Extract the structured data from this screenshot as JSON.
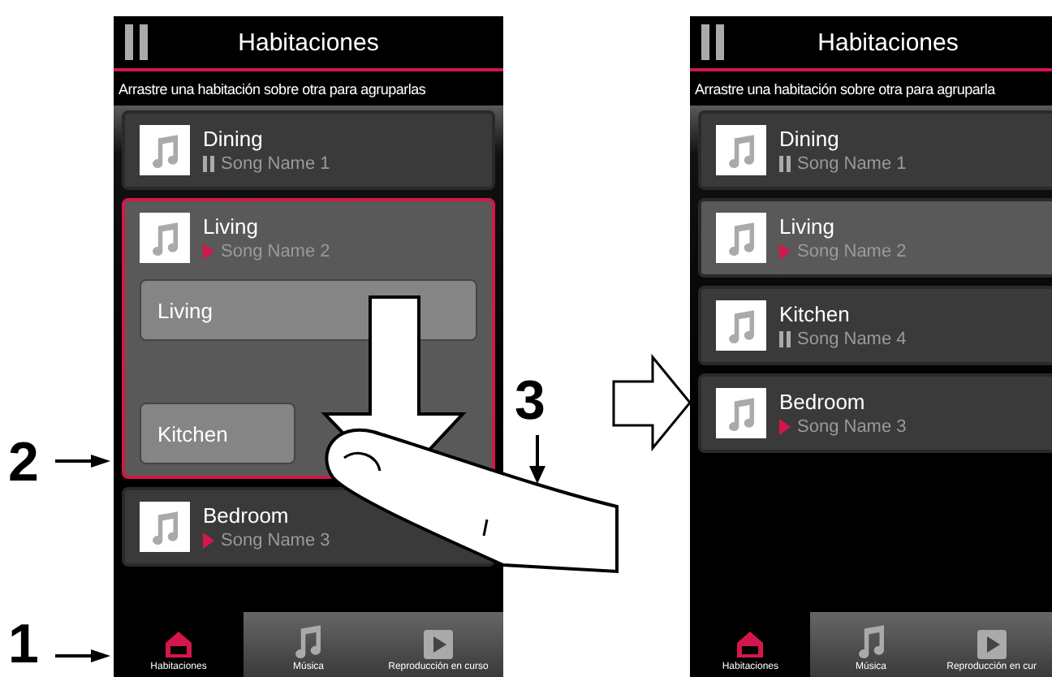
{
  "annotations": [
    {
      "label": "1"
    },
    {
      "label": "2"
    },
    {
      "label": "3"
    }
  ],
  "phones": [
    {
      "title": "Habitaciones",
      "hint": "Arrastre una habitación sobre otra para agruparlas",
      "rooms": [
        {
          "name": "Dining",
          "song": "Song Name 1",
          "playing": false,
          "selected": false,
          "drop_target": false
        },
        {
          "name": "Living",
          "song": "Song Name 2",
          "playing": true,
          "selected": true,
          "drop_target": true,
          "drop_slots": [
            "Living",
            "Kitchen"
          ]
        },
        {
          "name": "Bedroom",
          "song": "Song Name 3",
          "playing": true,
          "selected": false,
          "drop_target": false
        }
      ],
      "tabs": [
        {
          "label": "Habitaciones",
          "selected": true
        },
        {
          "label": "Música",
          "selected": false
        },
        {
          "label": "Reproducción en curso",
          "selected": false
        }
      ]
    },
    {
      "title": "Habitaciones",
      "hint": "Arrastre una habitación sobre otra para agruparla",
      "rooms": [
        {
          "name": "Dining",
          "song": "Song Name 1",
          "playing": false,
          "selected": false,
          "drop_target": false
        },
        {
          "name": "Living",
          "song": "Song Name 2",
          "playing": true,
          "selected": true,
          "drop_target": false
        },
        {
          "name": "Kitchen",
          "song": "Song Name 4",
          "playing": false,
          "selected": false,
          "drop_target": false
        },
        {
          "name": "Bedroom",
          "song": "Song Name 3",
          "playing": true,
          "selected": false,
          "drop_target": false
        }
      ],
      "tabs": [
        {
          "label": "Habitaciones",
          "selected": true
        },
        {
          "label": "Música",
          "selected": false
        },
        {
          "label": "Reproducción en cur",
          "selected": false
        }
      ]
    }
  ]
}
